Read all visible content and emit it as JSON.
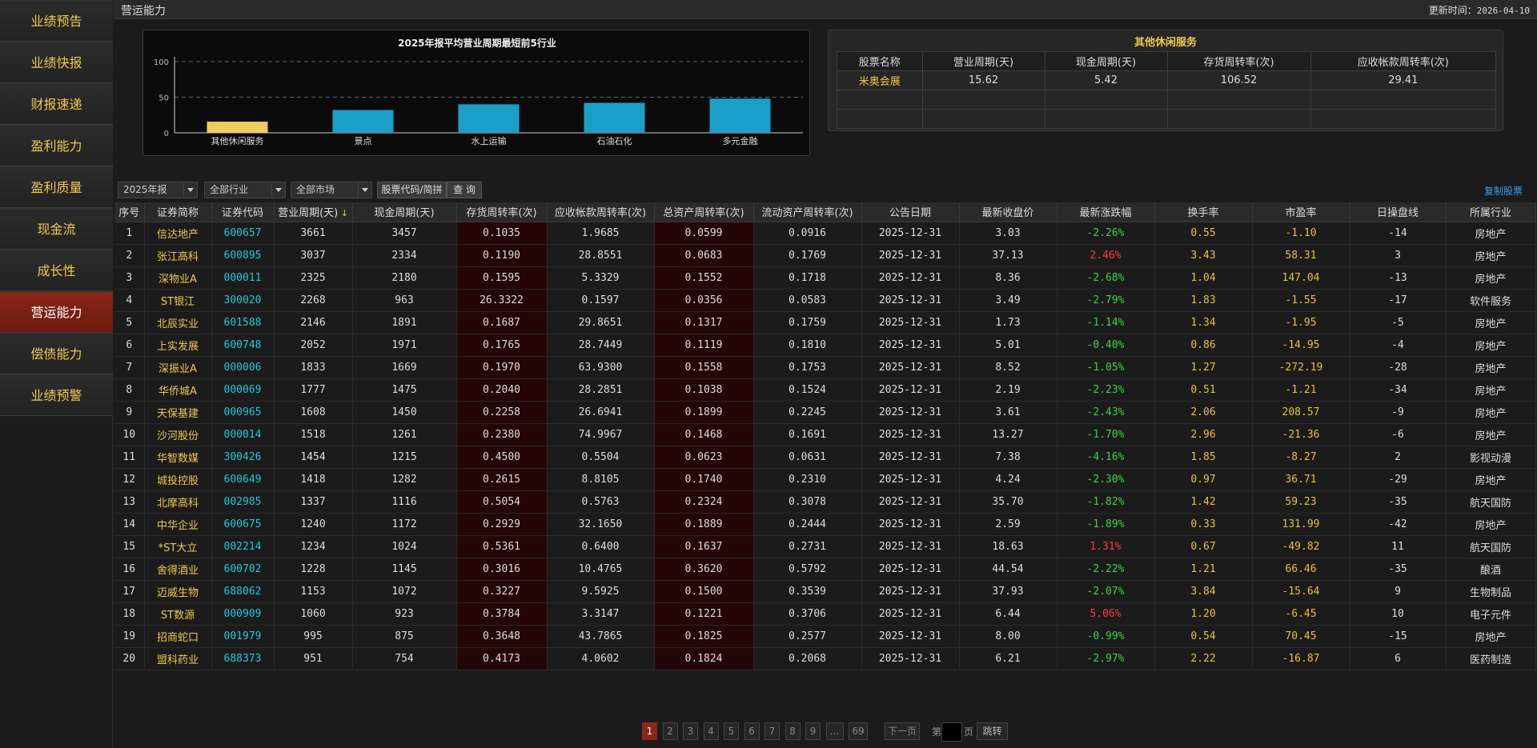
{
  "sidebar": {
    "items": [
      {
        "label": "业绩预告",
        "active": false
      },
      {
        "label": "业绩快报",
        "active": false
      },
      {
        "label": "财报速递",
        "active": false
      },
      {
        "label": "盈利能力",
        "active": false
      },
      {
        "label": "盈利质量",
        "active": false
      },
      {
        "label": "现金流",
        "active": false
      },
      {
        "label": "成长性",
        "active": false
      },
      {
        "label": "营运能力",
        "active": true
      },
      {
        "label": "偿债能力",
        "active": false
      },
      {
        "label": "业绩预警",
        "active": false
      }
    ]
  },
  "header": {
    "title": "营运能力",
    "update_label": "更新时间：",
    "update_time": "2026-04-10"
  },
  "chart_data": {
    "type": "bar",
    "title": "2025年报平均营业周期最短前5行业",
    "categories": [
      "其他休闲服务",
      "景点",
      "水上运输",
      "石油石化",
      "多元金融"
    ],
    "values": [
      15.62,
      32,
      40,
      42,
      48
    ],
    "ylim": [
      0,
      100
    ],
    "yticks": [
      0,
      50,
      100
    ],
    "grid": true,
    "highlight_color": "#f0cc60",
    "bar_color": "#1aa0c8"
  },
  "industry": {
    "title": "其他休闲服务",
    "headers": [
      "股票名称",
      "营业周期(天)",
      "现金周期(天)",
      "存货周转率(次)",
      "应收帐款周转率(次)"
    ],
    "rows": [
      [
        "米奥会展",
        "15.62",
        "5.42",
        "106.52",
        "29.41"
      ],
      [
        "",
        "",
        "",
        "",
        ""
      ],
      [
        "",
        "",
        "",
        "",
        ""
      ]
    ]
  },
  "filters": {
    "report": "2025年报",
    "industry": "全部行业",
    "market": "全部市场",
    "code_btn": "股票代码/简拼",
    "query_btn": "查 询",
    "copy": "复制股票"
  },
  "table": {
    "headers": [
      "序号",
      "证券简称",
      "证券代码",
      "营业周期(天)",
      "现金周期(天)",
      "存货周转率(次)",
      "应收帐款周转率(次)",
      "总资产周转率(次)",
      "流动资产周转率(次)",
      "公告日期",
      "最新收盘价",
      "最新涨跌幅",
      "换手率",
      "市盈率",
      "日操盘线",
      "所属行业"
    ],
    "rows": [
      [
        "1",
        "信达地产",
        "600657",
        "3661",
        "3457",
        "0.1035",
        "1.9685",
        "0.0599",
        "0.0916",
        "2025-12-31",
        "3.03",
        "-2.26%",
        "0.55",
        "-1.10",
        "-14",
        "房地产"
      ],
      [
        "2",
        "张江高科",
        "600895",
        "3037",
        "2334",
        "0.1190",
        "28.8551",
        "0.0683",
        "0.1769",
        "2025-12-31",
        "37.13",
        "2.46%",
        "3.43",
        "58.31",
        "3",
        "房地产"
      ],
      [
        "3",
        "深物业A",
        "000011",
        "2325",
        "2180",
        "0.1595",
        "5.3329",
        "0.1552",
        "0.1718",
        "2025-12-31",
        "8.36",
        "-2.68%",
        "1.04",
        "147.04",
        "-13",
        "房地产"
      ],
      [
        "4",
        "ST银江",
        "300020",
        "2268",
        "963",
        "26.3322",
        "0.1597",
        "0.0356",
        "0.0583",
        "2025-12-31",
        "3.49",
        "-2.79%",
        "1.83",
        "-1.55",
        "-17",
        "软件服务"
      ],
      [
        "5",
        "北辰实业",
        "601588",
        "2146",
        "1891",
        "0.1687",
        "29.8651",
        "0.1317",
        "0.1759",
        "2025-12-31",
        "1.73",
        "-1.14%",
        "1.34",
        "-1.95",
        "-5",
        "房地产"
      ],
      [
        "6",
        "上实发展",
        "600748",
        "2052",
        "1971",
        "0.1765",
        "28.7449",
        "0.1119",
        "0.1810",
        "2025-12-31",
        "5.01",
        "-0.40%",
        "0.86",
        "-14.95",
        "-4",
        "房地产"
      ],
      [
        "7",
        "深振业A",
        "000006",
        "1833",
        "1669",
        "0.1970",
        "63.9300",
        "0.1558",
        "0.1753",
        "2025-12-31",
        "8.52",
        "-1.05%",
        "1.27",
        "-272.19",
        "-28",
        "房地产"
      ],
      [
        "8",
        "华侨城A",
        "000069",
        "1777",
        "1475",
        "0.2040",
        "28.2851",
        "0.1038",
        "0.1524",
        "2025-12-31",
        "2.19",
        "-2.23%",
        "0.51",
        "-1.21",
        "-34",
        "房地产"
      ],
      [
        "9",
        "天保基建",
        "000965",
        "1608",
        "1450",
        "0.2258",
        "26.6941",
        "0.1899",
        "0.2245",
        "2025-12-31",
        "3.61",
        "-2.43%",
        "2.06",
        "208.57",
        "-9",
        "房地产"
      ],
      [
        "10",
        "沙河股份",
        "000014",
        "1518",
        "1261",
        "0.2380",
        "74.9967",
        "0.1468",
        "0.1691",
        "2025-12-31",
        "13.27",
        "-1.70%",
        "2.96",
        "-21.36",
        "-6",
        "房地产"
      ],
      [
        "11",
        "华智数媒",
        "300426",
        "1454",
        "1215",
        "0.4500",
        "0.5504",
        "0.0623",
        "0.0631",
        "2025-12-31",
        "7.38",
        "-4.16%",
        "1.85",
        "-8.27",
        "2",
        "影视动漫"
      ],
      [
        "12",
        "城投控股",
        "600649",
        "1418",
        "1282",
        "0.2615",
        "8.8105",
        "0.1740",
        "0.2310",
        "2025-12-31",
        "4.24",
        "-2.30%",
        "0.97",
        "36.71",
        "-29",
        "房地产"
      ],
      [
        "13",
        "北摩高科",
        "002985",
        "1337",
        "1116",
        "0.5054",
        "0.5763",
        "0.2324",
        "0.3078",
        "2025-12-31",
        "35.70",
        "-1.82%",
        "1.42",
        "59.23",
        "-35",
        "航天国防"
      ],
      [
        "14",
        "中华企业",
        "600675",
        "1240",
        "1172",
        "0.2929",
        "32.1650",
        "0.1889",
        "0.2444",
        "2025-12-31",
        "2.59",
        "-1.89%",
        "0.33",
        "131.99",
        "-42",
        "房地产"
      ],
      [
        "15",
        "*ST大立",
        "002214",
        "1234",
        "1024",
        "0.5361",
        "0.6400",
        "0.1637",
        "0.2731",
        "2025-12-31",
        "18.63",
        "1.31%",
        "0.67",
        "-49.82",
        "11",
        "航天国防"
      ],
      [
        "16",
        "舍得酒业",
        "600702",
        "1228",
        "1145",
        "0.3016",
        "10.4765",
        "0.3620",
        "0.5792",
        "2025-12-31",
        "44.54",
        "-2.22%",
        "1.21",
        "66.46",
        "-35",
        "酿酒"
      ],
      [
        "17",
        "迈威生物",
        "688062",
        "1153",
        "1072",
        "0.3227",
        "9.5925",
        "0.1500",
        "0.3539",
        "2025-12-31",
        "37.93",
        "-2.07%",
        "3.84",
        "-15.64",
        "9",
        "生物制品"
      ],
      [
        "18",
        "ST数源",
        "000909",
        "1060",
        "923",
        "0.3784",
        "3.3147",
        "0.1221",
        "0.3706",
        "2025-12-31",
        "6.44",
        "5.06%",
        "1.20",
        "-6.45",
        "10",
        "电子元件"
      ],
      [
        "19",
        "招商蛇口",
        "001979",
        "995",
        "875",
        "0.3648",
        "43.7865",
        "0.1825",
        "0.2577",
        "2025-12-31",
        "8.00",
        "-0.99%",
        "0.54",
        "70.45",
        "-15",
        "房地产"
      ],
      [
        "20",
        "盟科药业",
        "688373",
        "951",
        "754",
        "0.4173",
        "4.0602",
        "0.1824",
        "0.2068",
        "2025-12-31",
        "6.21",
        "-2.97%",
        "2.22",
        "-16.87",
        "6",
        "医药制造"
      ]
    ]
  },
  "pagination": {
    "pages": [
      "1",
      "2",
      "3",
      "4",
      "5",
      "6",
      "7",
      "8",
      "9",
      "...",
      "69"
    ],
    "active": "1",
    "next": "下一页",
    "prefix": "第",
    "suffix": "页",
    "jump": "跳转"
  },
  "icons": {
    "sort": "sort-desc-icon",
    "dropdown": "chevron-down-icon"
  }
}
